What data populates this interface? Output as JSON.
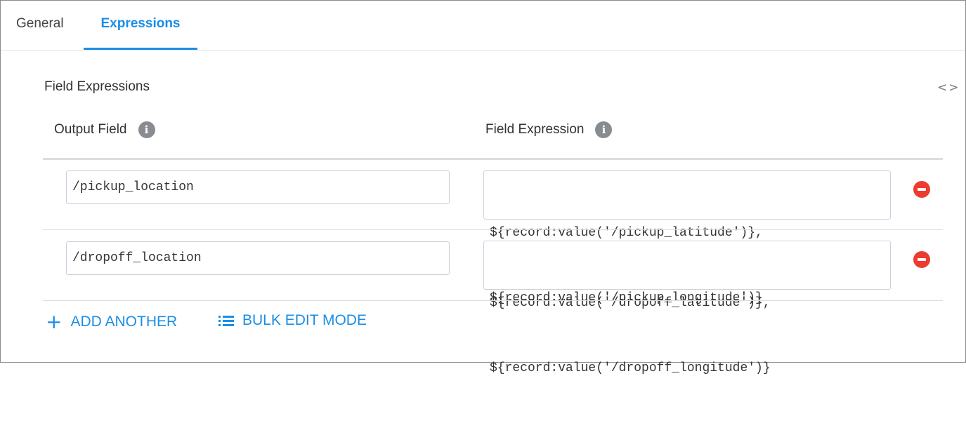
{
  "tabs": [
    {
      "label": "General",
      "active": false
    },
    {
      "label": "Expressions",
      "active": true
    }
  ],
  "section": {
    "title": "Field Expressions",
    "code_toggle": "<>"
  },
  "columns": {
    "output_field": "Output Field",
    "field_expression": "Field Expression",
    "info_icon": "i"
  },
  "rows": [
    {
      "output_field": "/pickup_location",
      "expression_line1": "${record:value('/pickup_latitude')},",
      "expression_line2": "${record:value('/pickup_longitude')}"
    },
    {
      "output_field": "/dropoff_location",
      "expression_line1": "${record:value('/dropoff_latitude')},",
      "expression_line2": "${record:value('/dropoff_longitude')}"
    }
  ],
  "actions": {
    "add_another": "ADD ANOTHER",
    "bulk_edit": "BULK EDIT MODE",
    "plus_glyph": "+"
  },
  "colors": {
    "accent": "#1a8ee6",
    "remove": "#ee3b2f",
    "info": "#888c90"
  }
}
